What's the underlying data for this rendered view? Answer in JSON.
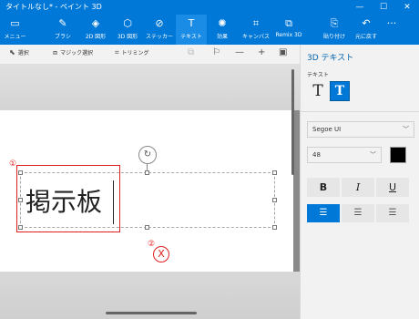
{
  "window": {
    "title": "タイトルなし* - ペイント 3D",
    "min_glyph": "—",
    "max_glyph": "☐",
    "close_glyph": "✕"
  },
  "ribbon": {
    "tools": [
      {
        "label": "メニュー",
        "icon": "folder-icon",
        "glyph": "▭"
      },
      {
        "label": "ブラシ",
        "icon": "brush-icon",
        "glyph": "✎"
      },
      {
        "label": "2D 図形",
        "icon": "2d-shapes-icon",
        "glyph": "◈"
      },
      {
        "label": "3D 図形",
        "icon": "3d-shapes-icon",
        "glyph": "⬡"
      },
      {
        "label": "ステッカー",
        "icon": "sticker-icon",
        "glyph": "⊘"
      },
      {
        "label": "テキスト",
        "icon": "text-icon",
        "glyph": "T"
      },
      {
        "label": "効果",
        "icon": "effects-icon",
        "glyph": "✺"
      },
      {
        "label": "キャンバス",
        "icon": "canvas-icon",
        "glyph": "⌗"
      },
      {
        "label": "Remix 3D",
        "icon": "remix3d-icon",
        "glyph": "⧉"
      },
      {
        "label": "貼り付け",
        "icon": "paste-icon",
        "glyph": "⎘"
      },
      {
        "label": "元に戻す",
        "icon": "undo-icon",
        "glyph": "↶"
      }
    ],
    "more_glyph": "···"
  },
  "toolbar": {
    "select": "選択",
    "magic_select": "マジック選択",
    "crop": "トリミング"
  },
  "canvas": {
    "text": "掲示板",
    "annotation_1": "①",
    "annotation_2": "②",
    "annotation_x": "X"
  },
  "panel": {
    "title": "3D テキスト",
    "subtitle": "テキスト",
    "font_family": "Segoe UI",
    "font_size": "48",
    "text_color": "#000000",
    "bold": "B",
    "italic": "I",
    "underline": "U",
    "alignment": "left"
  },
  "colors": {
    "accent": "#0078d7",
    "annotation": "#e02020"
  }
}
